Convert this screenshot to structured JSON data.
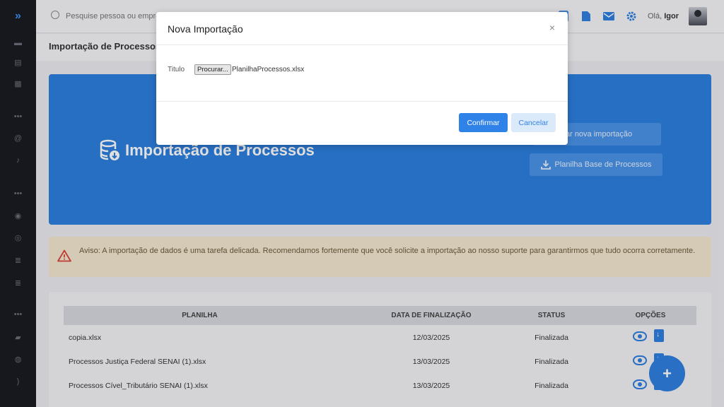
{
  "topbar": {
    "search_placeholder": "Pesquise pessoa ou empre",
    "greeting_prefix": "Olá,",
    "user_name": "Igor"
  },
  "page": {
    "title": "Importação de Processos"
  },
  "banner": {
    "title": "Importação de Processos",
    "new_import_label": "nar nova importação",
    "base_sheet_label": "Planilha Base de Processos"
  },
  "warning": {
    "text": "Aviso: A importação de dados é uma tarefa delicada. Recomendamos fortemente que você solicite a importação ao nosso suporte para garantirmos que tudo ocorra corretamente."
  },
  "table": {
    "headers": [
      "PLANILHA",
      "DATA DE FINALIZAÇÃO",
      "STATUS",
      "OPÇÕES"
    ],
    "rows": [
      {
        "name": "copia.xlsx",
        "date": "12/03/2025",
        "status": "Finalizada"
      },
      {
        "name": "Processos Justiça Federal SENAI (1).xlsx",
        "date": "13/03/2025",
        "status": "Finalizada"
      },
      {
        "name": "Processos Cível_Tributário SENAI (1).xlsx",
        "date": "13/03/2025",
        "status": "Finalizada"
      }
    ]
  },
  "fab": {
    "label": "+"
  },
  "modal": {
    "title": "Nova Importação",
    "close_label": "×",
    "field_label": "Titulo",
    "browse_label": "Procurar...",
    "file_name": "PlanilhaProcessos.xlsx",
    "confirm_label": "Confirmar",
    "cancel_label": "Cancelar"
  },
  "colors": {
    "accent": "#2f83e8",
    "banner": "#2d7fde",
    "sidebar": "#1b1c21",
    "warning_bg": "#f3e6cf",
    "danger": "#d9443a"
  },
  "icons": [
    "logo-chevron-icon",
    "search-icon",
    "calendar-icon",
    "document-icon",
    "mail-icon",
    "gear-icon",
    "database-icon",
    "download-icon",
    "warning-icon",
    "eye-icon",
    "file-download-icon"
  ]
}
